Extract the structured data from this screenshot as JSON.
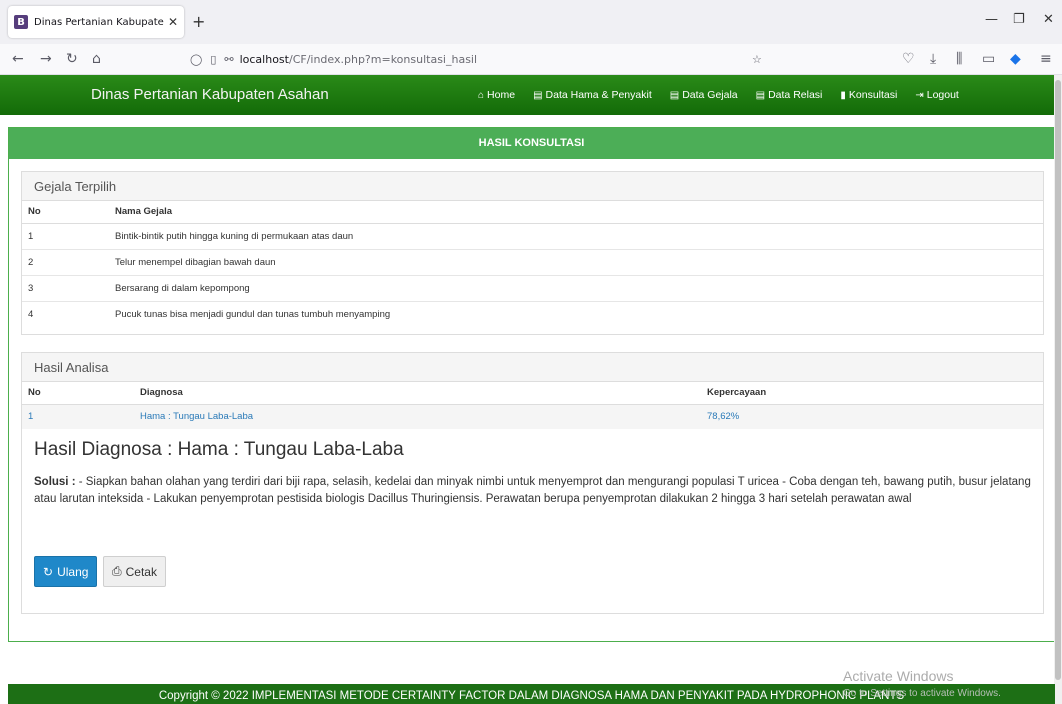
{
  "browser": {
    "tab_title": "Dinas Pertanian Kabupaten Asa",
    "favicon_letter": "B",
    "url_host": "localhost",
    "url_path": "/CF/index.php?m=konsultasi_hasil"
  },
  "site": {
    "brand": "Dinas Pertanian Kabupaten Asahan",
    "menu": [
      {
        "label": "Home",
        "icon": "home-icon"
      },
      {
        "label": "Data Hama & Penyakit",
        "icon": "list-icon"
      },
      {
        "label": "Data Gejala",
        "icon": "list-icon"
      },
      {
        "label": "Data Relasi",
        "icon": "list-icon"
      },
      {
        "label": "Konsultasi",
        "icon": "bar-chart-icon"
      },
      {
        "label": "Logout",
        "icon": "logout-icon"
      }
    ]
  },
  "panel": {
    "title": "HASIL KONSULTASI",
    "gejala": {
      "heading": "Gejala Terpilih",
      "col_no": "No",
      "col_nama": "Nama Gejala",
      "rows": [
        {
          "no": "1",
          "nama": "Bintik-bintik putih hingga kuning di permukaan atas daun"
        },
        {
          "no": "2",
          "nama": "Telur menempel dibagian bawah daun"
        },
        {
          "no": "3",
          "nama": "Bersarang di dalam kepompong"
        },
        {
          "no": "4",
          "nama": "Pucuk tunas bisa menjadi gundul dan tunas tumbuh menyamping"
        }
      ]
    },
    "analisa": {
      "heading": "Hasil Analisa",
      "col_no": "No",
      "col_diagnosa": "Diagnosa",
      "col_kepercayaan": "Kepercayaan",
      "rows": [
        {
          "no": "1",
          "diagnosa": "Hama : Tungau Laba-Laba",
          "kepercayaan": "78,62%"
        }
      ]
    },
    "diagnosa_title": "Hasil Diagnosa : Hama : Tungau Laba-Laba",
    "solusi_label": "Solusi :",
    "solusi_text": " - Siapkan bahan olahan yang terdiri dari biji rapa, selasih, kedelai dan minyak nimbi untuk menyemprot dan mengurangi populasi T uricea - Coba dengan teh, bawang putih, busur jelatang atau larutan inteksida - Lakukan penyemprotan pestisida biologis Dacillus Thuringiensis. Perawatan berupa penyemprotan dilakukan 2 hingga 3 hari setelah perawatan awal",
    "btn_ulang": "Ulang",
    "btn_cetak": "Cetak"
  },
  "footer": "Copyright © 2022 IMPLEMENTASI METODE CERTAINTY FACTOR DALAM DIAGNOSA HAMA DAN PENYAKIT PADA HYDROPHONIC PLANTS",
  "watermark": {
    "line1": "Activate Windows",
    "line2": "Go to Settings to activate Windows."
  }
}
